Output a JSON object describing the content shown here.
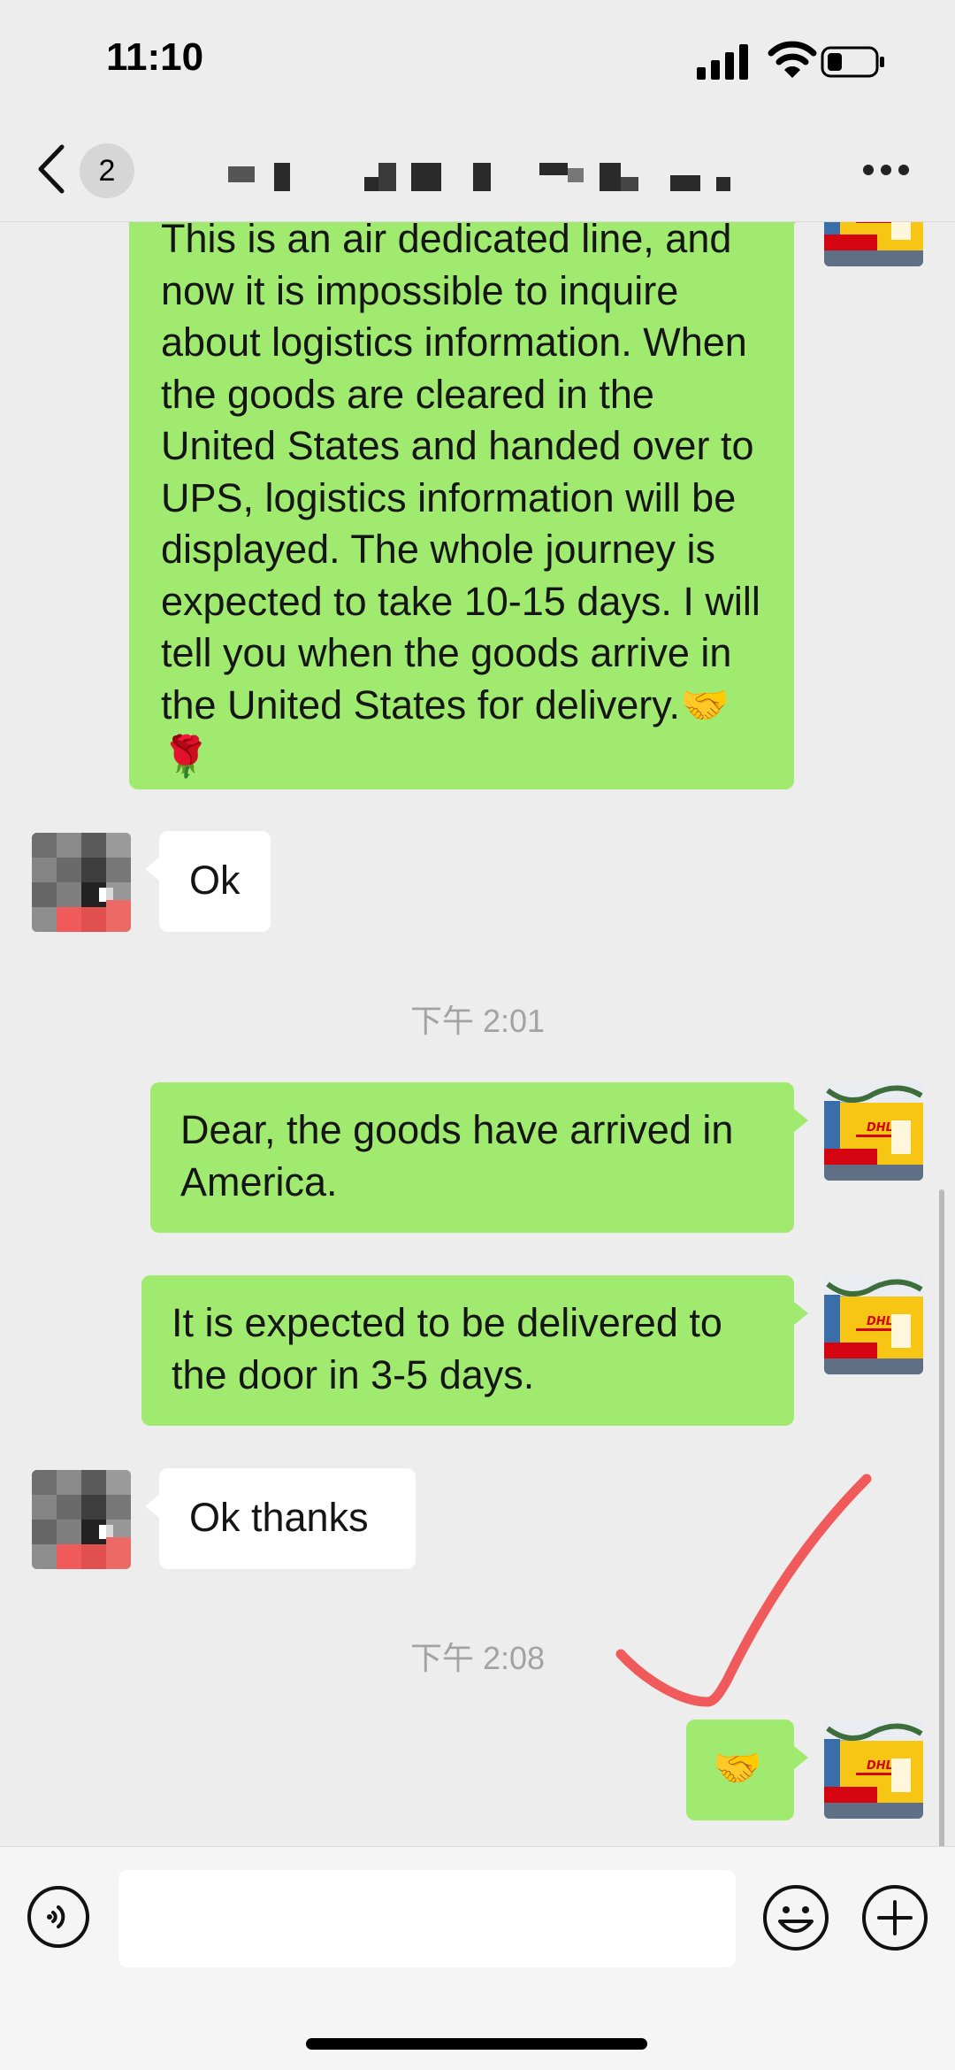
{
  "status_bar": {
    "time": "11:10"
  },
  "nav": {
    "unread_badge": "2"
  },
  "messages": [
    {
      "side": "me",
      "text": "This is an air dedicated line, and now it is impossible to inquire about logistics information. When the goods are cleared in the United States and handed over to UPS, logistics information will be displayed. The whole journey is expected to take 10-15 days. I will tell you when the goods arrive in the United States for delivery.🤝🌹"
    },
    {
      "side": "them",
      "text": "Ok"
    },
    {
      "timestamp": "下午 2:01"
    },
    {
      "side": "me",
      "text": "Dear, the goods have arrived in America."
    },
    {
      "side": "me",
      "text": "It is expected to be delivered to the door in 3-5 days."
    },
    {
      "side": "them",
      "text": "Ok thanks"
    },
    {
      "timestamp": "下午 2:08"
    },
    {
      "side": "me",
      "text": "🤝"
    }
  ],
  "avatars": {
    "me": "dhl-office-avatar",
    "them": "pixelated-avatar"
  },
  "icons": [
    "back-chevron-icon",
    "more-dots-icon",
    "voice-icon",
    "emoji-icon",
    "plus-icon",
    "signal-icon",
    "wifi-icon",
    "battery-icon"
  ],
  "colors": {
    "my_bubble": "#a0ea6f",
    "their_bubble": "#ffffff",
    "background": "#ededed",
    "annotation_check": "#f05a5a"
  }
}
